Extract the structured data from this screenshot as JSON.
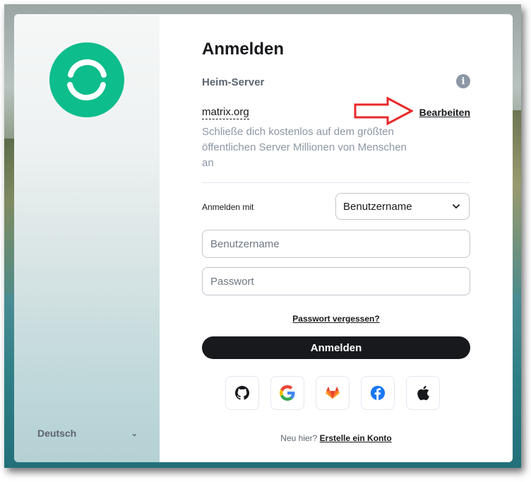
{
  "colors": {
    "brand_green": "#0dbd8b",
    "primary_text": "#17191c",
    "muted_text": "#8d97a5",
    "annotation_arrow": "#e8282b"
  },
  "sidebar": {
    "logo_icon": "element-logo-icon",
    "language": "Deutsch"
  },
  "login": {
    "title": "Anmelden",
    "homeserver_label": "Heim-Server",
    "info_icon": "info-icon",
    "server_name": "matrix.org",
    "edit_label": "Bearbeiten",
    "server_description": "Schließe dich kostenlos auf dem größten öffentlichen Server Millionen von Menschen an",
    "login_with_label": "Anmelden mit",
    "login_type_selected": "Benutzername",
    "username_placeholder": "Benutzername",
    "password_placeholder": "Passwort",
    "forgot_password": "Passwort vergessen?",
    "submit_label": "Anmelden",
    "sso_providers": [
      "github-icon",
      "google-icon",
      "gitlab-icon",
      "facebook-icon",
      "apple-icon"
    ],
    "new_here": "Neu hier?",
    "create_account": "Erstelle ein Konto"
  }
}
